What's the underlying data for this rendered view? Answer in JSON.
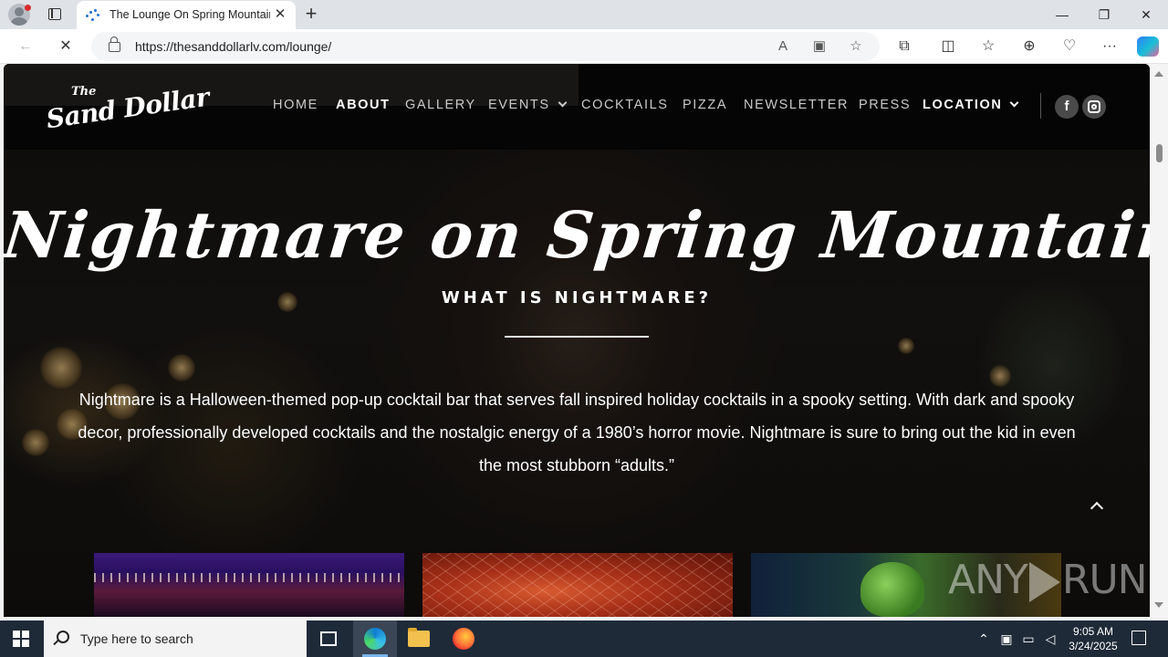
{
  "browser": {
    "tab_title": "The Lounge On Spring Mountain",
    "url": "https://thesanddollarlv.com/lounge/",
    "new_tab_label": "+",
    "tab_close_label": "✕"
  },
  "site": {
    "logo_the": "The",
    "logo_name": "Sand Dollar",
    "nav": [
      {
        "label": "HOME"
      },
      {
        "label": "ABOUT"
      },
      {
        "label": "GALLERY"
      },
      {
        "label": "EVENTS"
      },
      {
        "label": "COCKTAILS"
      },
      {
        "label": "PIZZA"
      },
      {
        "label": "NEWSLETTER"
      },
      {
        "label": "PRESS"
      },
      {
        "label": "LOCATION"
      }
    ],
    "social": {
      "facebook": "f"
    }
  },
  "hero": {
    "title": "Nightmare on Spring Mountain",
    "subtitle": "WHAT IS NIGHTMARE?",
    "body": "Nightmare is a Halloween-themed pop-up cocktail bar that serves fall inspired holiday cocktails in a spooky setting. With dark and spooky decor, professionally developed cocktails and the nostalgic energy of a 1980’s horror movie. Nightmare is sure to bring out the kid in even the most stubborn “adults.”"
  },
  "watermark": {
    "left": "ANY",
    "right": "RUN"
  },
  "taskbar": {
    "search_placeholder": "Type here to search",
    "time": "9:05 AM",
    "date": "3/24/2025"
  },
  "colors": {
    "nav_strip": "#050505",
    "nav_text": "#c9c9c9",
    "nav_active": "#ffffff",
    "taskbar": "#1f2a38"
  },
  "icons": {
    "back": "arrow-left-icon",
    "reload": "stop-icon",
    "read_aloud": "read-aloud-icon",
    "immersive": "immersive-reader-icon",
    "favorite": "star-icon",
    "extensions": "puzzle-icon",
    "split": "split-screen-icon",
    "favorites": "favorites-icon",
    "collections": "collections-icon",
    "browser_essentials": "heart-pulse-icon",
    "more": "more-icon"
  }
}
